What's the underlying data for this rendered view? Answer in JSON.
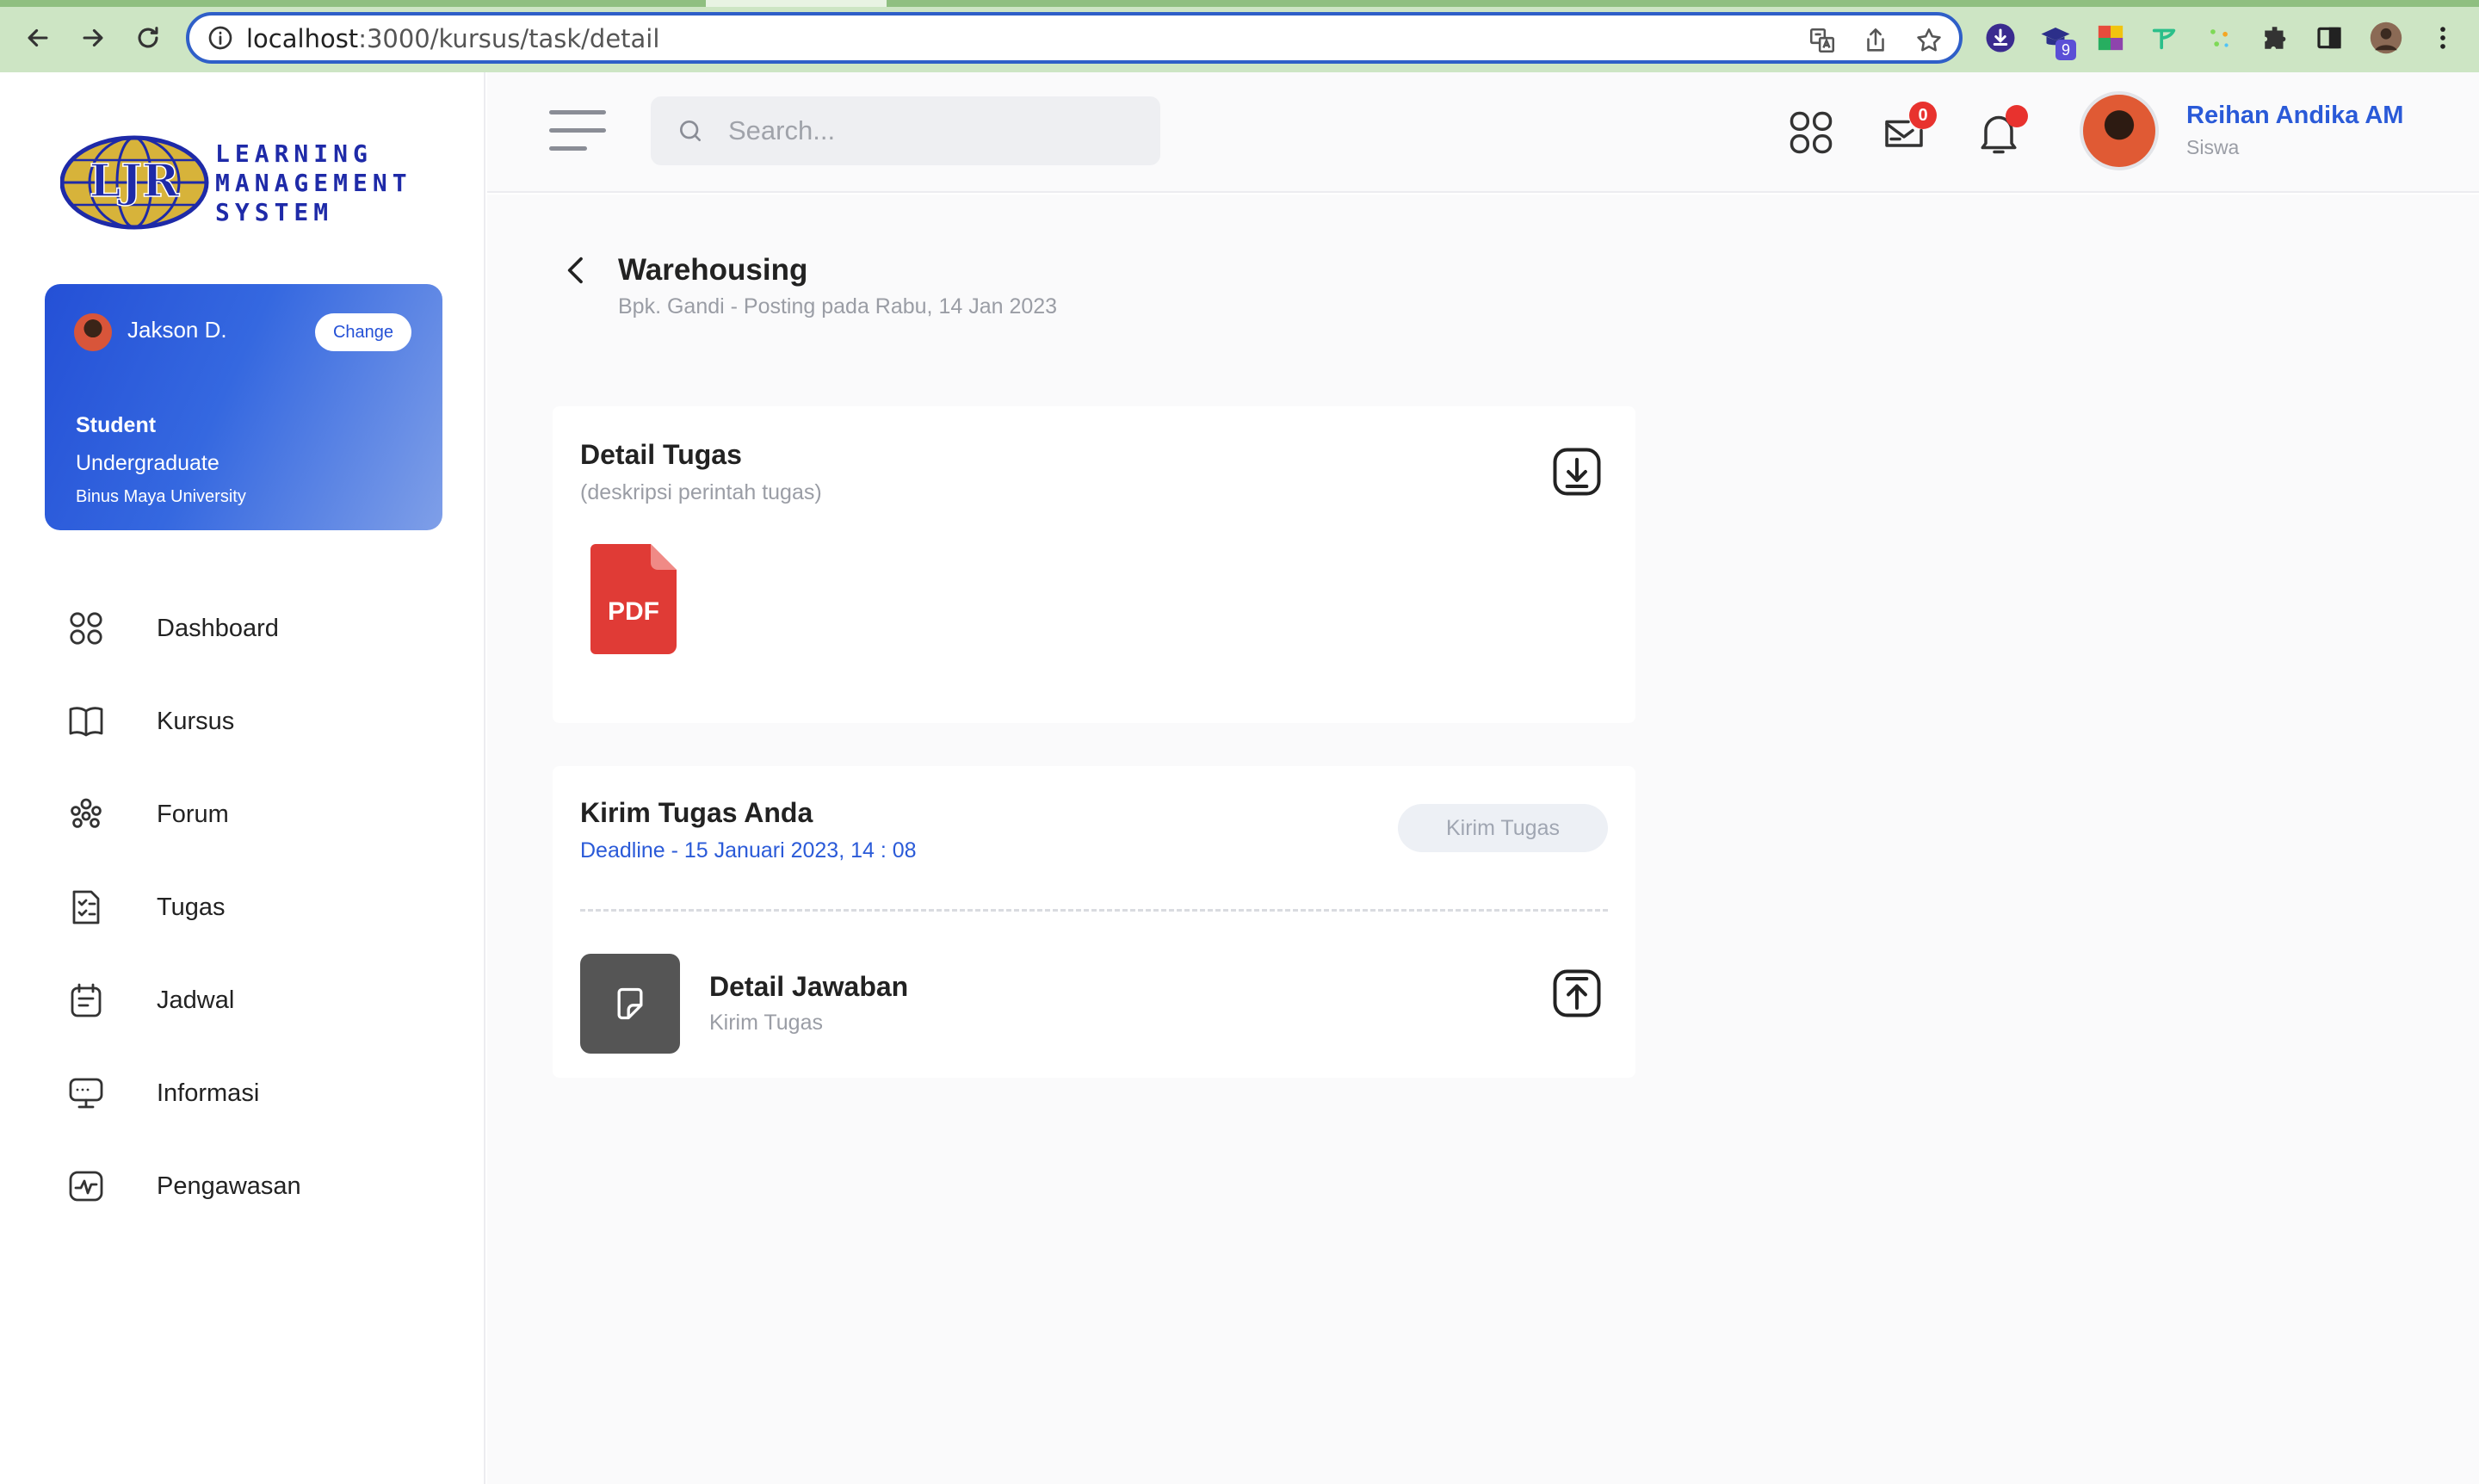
{
  "browser": {
    "url_host": "localhost",
    "url_path": ":3000/kursus/task/detail",
    "extension_badge": "9"
  },
  "colors": {
    "accent": "#2a5ad8",
    "card_gradient_start": "#2450d6",
    "card_gradient_end": "#7f9fe8",
    "notification": "#e8322e"
  },
  "sidebar": {
    "logo": {
      "mark": "LJR",
      "line1": "LEARNING",
      "line2": "MANAGEMENT",
      "line3": "SYSTEM"
    },
    "profile": {
      "name": "Jakson D.",
      "change_label": "Change",
      "role": "Student",
      "level": "Undergraduate",
      "university": "Binus Maya University"
    },
    "items": [
      {
        "label": "Dashboard",
        "icon": "dashboard-icon"
      },
      {
        "label": "Kursus",
        "icon": "book-icon"
      },
      {
        "label": "Forum",
        "icon": "forum-icon"
      },
      {
        "label": "Tugas",
        "icon": "task-icon"
      },
      {
        "label": "Jadwal",
        "icon": "calendar-icon"
      },
      {
        "label": "Informasi",
        "icon": "monitor-icon"
      },
      {
        "label": "Pengawasan",
        "icon": "activity-icon"
      }
    ]
  },
  "topbar": {
    "search_placeholder": "Search...",
    "messages_count": "0",
    "user_name": "Reihan Andika AM",
    "user_role": "Siswa"
  },
  "main": {
    "title": "Warehousing",
    "subtitle": "Bpk. Gandi - Posting pada Rabu, 14 Jan 2023",
    "detail_card": {
      "title": "Detail Tugas",
      "subtitle": "(deskripsi perintah tugas)",
      "file_label": "PDF"
    },
    "submit_card": {
      "title": "Kirim Tugas Anda",
      "deadline": "Deadline - 15 Januari 2023, 14 : 08",
      "button_label": "Kirim Tugas",
      "answer_title": "Detail Jawaban",
      "answer_subtitle": "Kirim Tugas"
    }
  }
}
